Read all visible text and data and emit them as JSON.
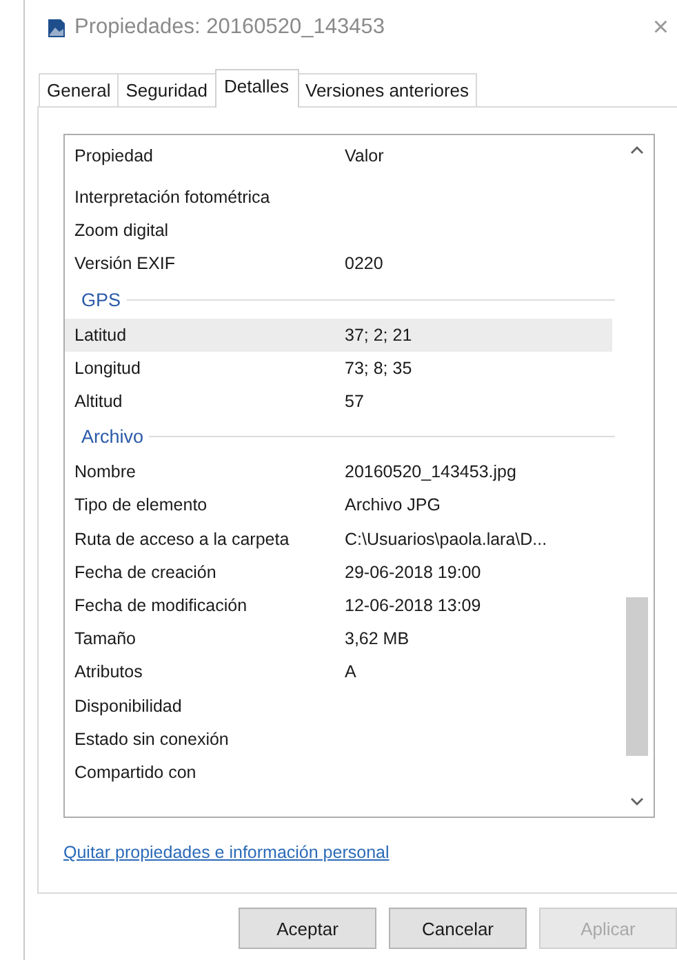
{
  "window": {
    "title": "Propiedades: 20160520_143453",
    "close": "×"
  },
  "tabs": [
    {
      "label": "General",
      "selected": false
    },
    {
      "label": "Seguridad",
      "selected": false
    },
    {
      "label": "Detalles",
      "selected": true
    },
    {
      "label": "Versiones anteriores",
      "selected": false
    }
  ],
  "table": {
    "columns": [
      "Propiedad",
      "Valor"
    ],
    "rows": [
      {
        "kind": "row",
        "name": "Interpretación fotométrica",
        "value": "",
        "highlighted": false
      },
      {
        "kind": "row",
        "name": "Zoom digital",
        "value": "",
        "highlighted": false
      },
      {
        "kind": "row",
        "name": "Versión EXIF",
        "value": "0220",
        "highlighted": false
      },
      {
        "kind": "group",
        "name": "GPS"
      },
      {
        "kind": "row",
        "name": "Latitud",
        "value": "37; 2; 21",
        "highlighted": true
      },
      {
        "kind": "row",
        "name": "Longitud",
        "value": "73; 8; 35",
        "highlighted": false
      },
      {
        "kind": "row",
        "name": "Altitud",
        "value": "57",
        "highlighted": false
      },
      {
        "kind": "group",
        "name": "Archivo"
      },
      {
        "kind": "row",
        "name": "Nombre",
        "value": "20160520_143453.jpg",
        "highlighted": false
      },
      {
        "kind": "row",
        "name": "Tipo de elemento",
        "value": "Archivo JPG",
        "highlighted": false
      },
      {
        "kind": "row",
        "name": "Ruta de acceso a la carpeta",
        "value": "C:\\Usuarios\\paola.lara\\D...",
        "highlighted": false
      },
      {
        "kind": "row",
        "name": "Fecha de creación",
        "value": "29-06-2018 19:00",
        "highlighted": false
      },
      {
        "kind": "row",
        "name": "Fecha de modificación",
        "value": "12-06-2018 13:09",
        "highlighted": false
      },
      {
        "kind": "row",
        "name": "Tamaño",
        "value": "3,62 MB",
        "highlighted": false
      },
      {
        "kind": "row",
        "name": "Atributos",
        "value": "A",
        "highlighted": false
      },
      {
        "kind": "row",
        "name": "Disponibilidad",
        "value": "",
        "highlighted": false
      },
      {
        "kind": "row",
        "name": "Estado sin conexión",
        "value": "",
        "highlighted": false
      },
      {
        "kind": "row",
        "name": "Compartido con",
        "value": "",
        "highlighted": false
      }
    ]
  },
  "link": "Quitar propiedades e información personal",
  "buttons": [
    {
      "label": "Aceptar",
      "disabled": false
    },
    {
      "label": "Cancelar",
      "disabled": false
    },
    {
      "label": "Aplicar",
      "disabled": true
    }
  ]
}
